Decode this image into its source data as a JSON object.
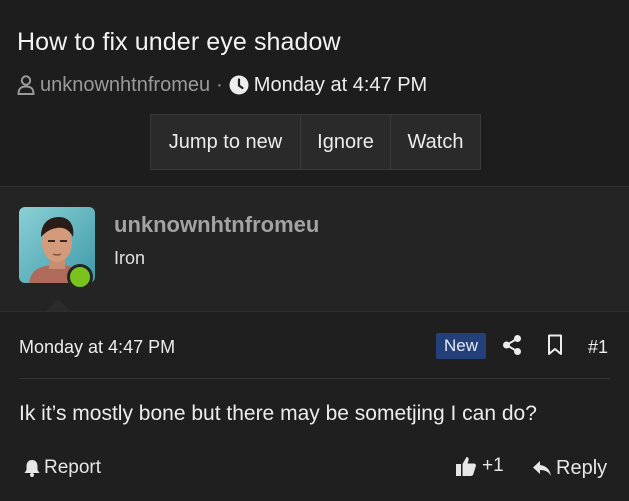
{
  "thread": {
    "title": "How to fix under eye shadow",
    "author": "unknownhtnfromeu",
    "separator": "·",
    "date": "Monday at 4:47 PM",
    "buttons": {
      "jump_to_new": "Jump to new",
      "ignore": "Ignore",
      "watch": "Watch"
    }
  },
  "post": {
    "username": "unknownhtnfromeu",
    "user_title": "Iron",
    "online_status_color": "#7ac21e",
    "date": "Monday at 4:47 PM",
    "badge": "New",
    "number": "#1",
    "message": "Ik it’s mostly bone but there may be sometjing I can do?",
    "actions": {
      "report": "Report",
      "reaction_count": "+1",
      "reply": "Reply"
    }
  },
  "icons": {
    "author": "user-icon",
    "time": "clock-icon",
    "share": "share-icon",
    "bookmark": "bookmark-icon",
    "report": "bell-icon",
    "like": "thumbs-up-icon",
    "reply": "reply-icon"
  },
  "colors": {
    "background": "#1d1d1d",
    "post_background": "#242424",
    "badge": "#23407a",
    "online": "#7ac21e"
  }
}
